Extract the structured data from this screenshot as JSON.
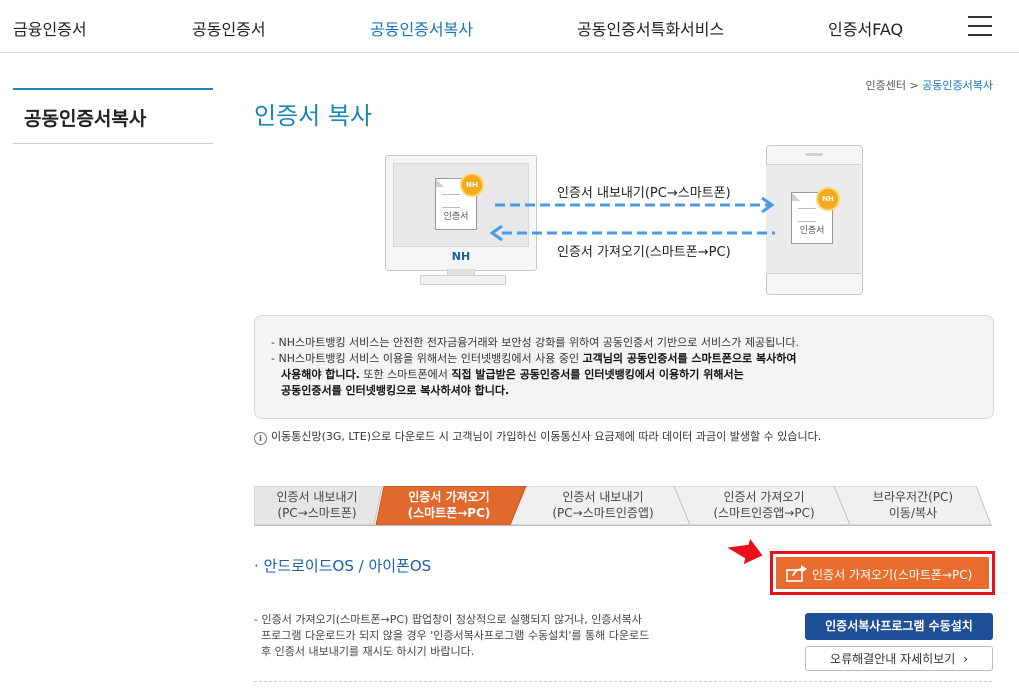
{
  "nav": {
    "items": [
      "금융인증서",
      "공동인증서",
      "공동인증서복사",
      "공동인증서특화서비스",
      "인증서FAQ"
    ],
    "active_index": 2
  },
  "sidebar": {
    "title": "공동인증서복사"
  },
  "breadcrumb": {
    "home": "인증센터",
    "separator": ">",
    "current": "공동인증서복사"
  },
  "page": {
    "title": "인증서 복사"
  },
  "illustration": {
    "export_label": "인증서 내보내기(PC→스마트폰)",
    "import_label": "인증서 가져오기(스마트폰→PC)",
    "cert_text": "인증서",
    "badge_text": "NH",
    "monitor_logo": "NH"
  },
  "notice": {
    "line1": "- NH스마트뱅킹 서비스는 안전한 전자금융거래와 보안성 강화를 위하여 공동인증서 기반으로 서비스가 제공됩니다.",
    "line2_a": "- NH스마트뱅킹 서비스 이용을 위해서는 인터넷뱅킹에서 사용 중인 ",
    "line2_b": "고객님의 공동인증서를 스마트폰으로 복사하여",
    "line3_b": "사용해야 합니다.",
    "line3_a": " 또한 스마트폰에서 ",
    "line3_c": "직접 발급받은 공동인증서를 인터넷뱅킹에서 이용하기 위해서는",
    "line4_b": "공동인증서를 인터넷뱅킹으로 복사하셔야 합니다."
  },
  "info": {
    "icon": "i",
    "text": "이동통신망(3G, LTE)으로 다운로드 시 고객님이 가입하신 이동통신사 요금제에 따라 데이터 과금이 발생할 수 있습니다."
  },
  "tabs": [
    {
      "line1": "인증서 내보내기",
      "line2": "(PC→스마트폰)"
    },
    {
      "line1": "인증서 가져오기",
      "line2": "(스마트폰→PC)"
    },
    {
      "line1": "인증서 내보내기",
      "line2": "(PC→스마트인증앱)"
    },
    {
      "line1": "인증서 가져오기",
      "line2": "(스마트인증앱→PC)"
    },
    {
      "line1": "브라우저간(PC)",
      "line2": "이동/복사"
    }
  ],
  "active_tab_index": 1,
  "section": {
    "title": "· 안드로이드OS / 아이폰OS",
    "action_button": "인증서 가져오기(스마트폰→PC)",
    "note_lines": [
      "- 인증서 가져오기(스마트폰→PC) 팝업창이 정상적으로 실행되지 않거나, 인증서복사",
      "  프로그램 다운로드가 되지 않을 경우 '인증서복사프로그램 수동설치'를 통해 다운로드",
      "  후 인증서 내보내기를 재시도 하시기 바랍니다."
    ],
    "manual_install_button": "인증서복사프로그램 수동설치",
    "help_button": "오류해결안내 자세히보기",
    "help_chevron": "›"
  },
  "colors": {
    "accent_blue": "#1576b8",
    "title_blue": "#1a86b8",
    "tab_active": "#e0692e",
    "button_orange": "#e86c2e",
    "highlight_red": "#e8101a",
    "button_navy": "#1f4f96",
    "arrow_blue": "#4a9ae8"
  }
}
